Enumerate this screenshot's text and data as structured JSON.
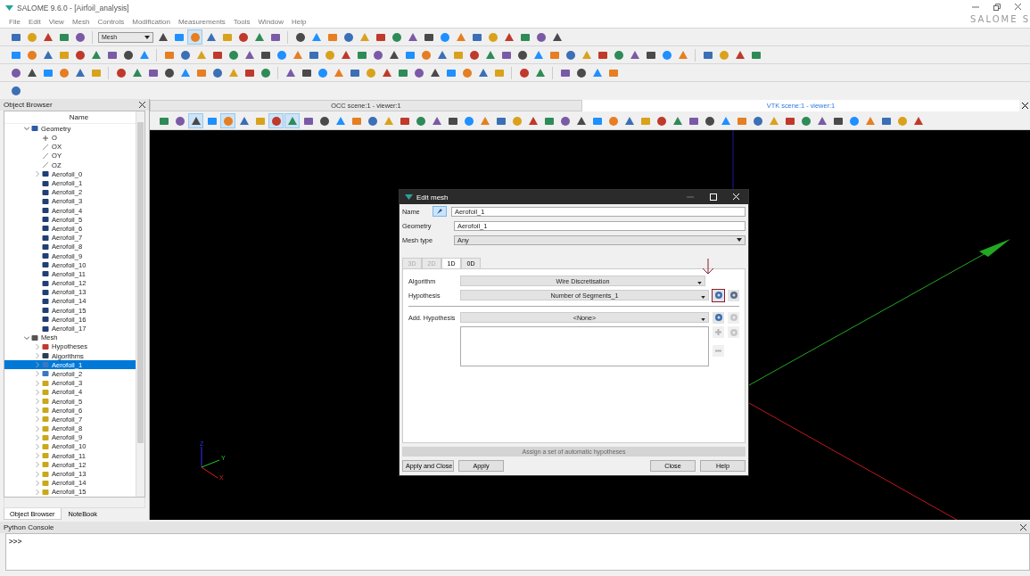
{
  "window": {
    "title": "SALOME 9.6.0 - [Airfoil_analysis]",
    "logo_text": "SALOME S"
  },
  "menu": [
    "File",
    "Edit",
    "View",
    "Mesh",
    "Controls",
    "Modification",
    "Measurements",
    "Tools",
    "Window",
    "Help"
  ],
  "toolbar": {
    "module": "Mesh"
  },
  "object_browser": {
    "title": "Object Browser",
    "column": "Name",
    "tree": [
      {
        "label": "Geometry",
        "kind": "geometry",
        "expanded": true,
        "selected": false,
        "children": [
          {
            "label": "O",
            "kind": "point",
            "selected": false
          },
          {
            "label": "OX",
            "kind": "vector",
            "selected": false
          },
          {
            "label": "OY",
            "kind": "vector",
            "selected": false
          },
          {
            "label": "OZ",
            "kind": "vector",
            "selected": false
          },
          {
            "label": "Aerofoil_0",
            "kind": "shape",
            "expanded": false,
            "selected": false
          },
          {
            "label": "Aerofoil_1",
            "kind": "shape",
            "selected": false
          },
          {
            "label": "Aerofoil_2",
            "kind": "shape",
            "selected": false
          },
          {
            "label": "Aerofoil_3",
            "kind": "shape",
            "selected": false
          },
          {
            "label": "Aerofoil_4",
            "kind": "shape",
            "selected": false
          },
          {
            "label": "Aerofoil_5",
            "kind": "shape",
            "selected": false
          },
          {
            "label": "Aerofoil_6",
            "kind": "shape",
            "selected": false
          },
          {
            "label": "Aerofoil_7",
            "kind": "shape",
            "selected": false
          },
          {
            "label": "Aerofoil_8",
            "kind": "shape",
            "selected": false
          },
          {
            "label": "Aerofoil_9",
            "kind": "shape",
            "selected": false
          },
          {
            "label": "Aerofoil_10",
            "kind": "shape",
            "selected": false
          },
          {
            "label": "Aerofoil_11",
            "kind": "shape",
            "selected": false
          },
          {
            "label": "Aerofoil_12",
            "kind": "shape",
            "selected": false
          },
          {
            "label": "Aerofoil_13",
            "kind": "shape",
            "selected": false
          },
          {
            "label": "Aerofoil_14",
            "kind": "shape",
            "selected": false
          },
          {
            "label": "Aerofoil_15",
            "kind": "shape",
            "selected": false
          },
          {
            "label": "Aerofoil_16",
            "kind": "shape",
            "selected": false
          },
          {
            "label": "Aerofoil_17",
            "kind": "shape",
            "selected": false
          }
        ]
      },
      {
        "label": "Mesh",
        "kind": "mesh-module",
        "expanded": true,
        "selected": false,
        "children": [
          {
            "label": "Hypotheses",
            "kind": "hypotheses",
            "expanded": false,
            "selected": false
          },
          {
            "label": "Algorithms",
            "kind": "algorithms",
            "expanded": false,
            "selected": false
          },
          {
            "label": "Aerofoil_1",
            "kind": "mesh",
            "expanded": false,
            "selected": true
          },
          {
            "label": "Aerofoil_2",
            "kind": "mesh",
            "expanded": false,
            "selected": false
          },
          {
            "label": "Aerofoil_3",
            "kind": "mesh-warning",
            "expanded": false,
            "selected": false
          },
          {
            "label": "Aerofoil_4",
            "kind": "mesh-warning",
            "expanded": false,
            "selected": false
          },
          {
            "label": "Aerofoil_5",
            "kind": "mesh-warning",
            "expanded": false,
            "selected": false
          },
          {
            "label": "Aerofoil_6",
            "kind": "mesh-warning",
            "expanded": false,
            "selected": false
          },
          {
            "label": "Aerofoil_7",
            "kind": "mesh-warning",
            "expanded": false,
            "selected": false
          },
          {
            "label": "Aerofoil_8",
            "kind": "mesh-warning",
            "expanded": false,
            "selected": false
          },
          {
            "label": "Aerofoil_9",
            "kind": "mesh-warning",
            "expanded": false,
            "selected": false
          },
          {
            "label": "Aerofoil_10",
            "kind": "mesh-warning",
            "expanded": false,
            "selected": false
          },
          {
            "label": "Aerofoil_11",
            "kind": "mesh-warning",
            "expanded": false,
            "selected": false
          },
          {
            "label": "Aerofoil_12",
            "kind": "mesh-warning",
            "expanded": false,
            "selected": false
          },
          {
            "label": "Aerofoil_13",
            "kind": "mesh-warning",
            "expanded": false,
            "selected": false
          },
          {
            "label": "Aerofoil_14",
            "kind": "mesh-warning",
            "expanded": false,
            "selected": false
          },
          {
            "label": "Aerofoil_15",
            "kind": "mesh-warning",
            "expanded": false,
            "selected": false
          }
        ]
      }
    ],
    "tabs": [
      {
        "label": "Object Browser",
        "selected": true
      },
      {
        "label": "NoteBook",
        "selected": false
      }
    ]
  },
  "viewer": {
    "tabs": [
      {
        "label": "OCC scene:1 - viewer:1",
        "selected": false
      },
      {
        "label": "VTK scene:1 - viewer:1",
        "selected": true
      }
    ],
    "axis_labels": [
      "Z",
      "Y",
      "X"
    ]
  },
  "dialog": {
    "title": "Edit mesh",
    "fields": [
      {
        "label": "Name",
        "value": "Aerofoil_1",
        "kind": "name"
      },
      {
        "label": "Geometry",
        "value": "Aerofoil_1",
        "kind": "text"
      },
      {
        "label": "Mesh type",
        "value": "Any",
        "kind": "combo"
      }
    ],
    "tabs": [
      {
        "label": "3D",
        "selected": false,
        "disabled": true
      },
      {
        "label": "2D",
        "selected": false,
        "disabled": true
      },
      {
        "label": "1D",
        "selected": true,
        "disabled": false
      },
      {
        "label": "0D",
        "selected": false,
        "disabled": false
      }
    ],
    "algorithm": {
      "label": "Algorithm",
      "value": "Wire Discretisation"
    },
    "hypothesis": {
      "label": "Hypothesis",
      "value": "Number of Segments_1"
    },
    "add_hypothesis": {
      "label": "Add. Hypothesis",
      "value": "<None>"
    },
    "auto_button": "Assign a set of automatic hypotheses",
    "buttons": [
      "Apply and Close",
      "Apply",
      "Close",
      "Help"
    ]
  },
  "python_console": {
    "title": "Python Console",
    "prompt": ">>>"
  }
}
